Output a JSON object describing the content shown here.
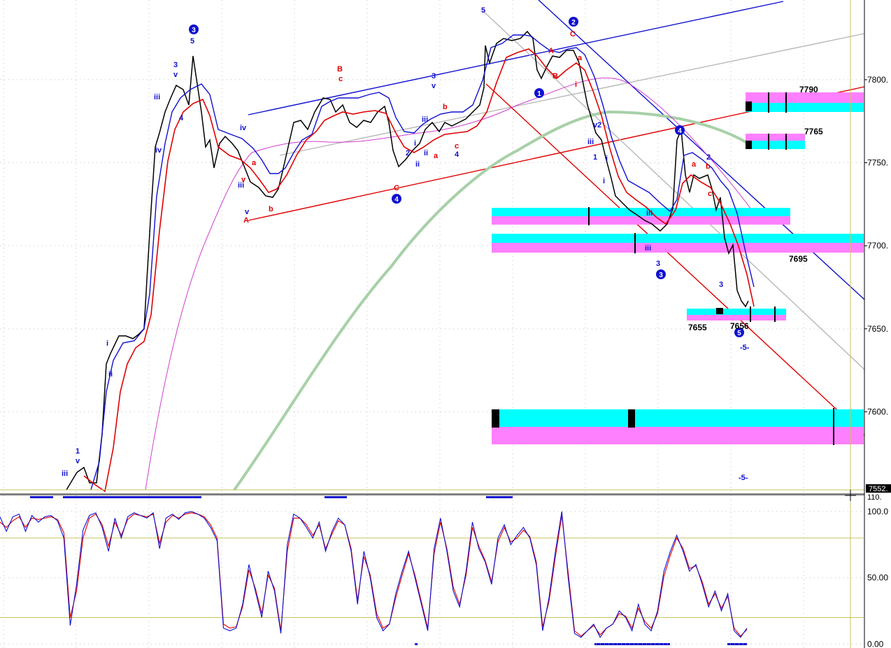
{
  "colors": {
    "blue": "#1010d0",
    "red": "#e00000",
    "magenta": "#d040d0",
    "lightgreen": "#a8d0a8",
    "gray": "#b8b8b8",
    "cyan": "#00ffff",
    "pink": "#ff80ff",
    "olive": "#c8c060",
    "dots": "#c0c0c0"
  },
  "chart_data": [
    {
      "type": "line",
      "panel": "price",
      "y_ticks": [
        {
          "value": 7800,
          "label": "7800."
        },
        {
          "value": 7750,
          "label": "7750."
        },
        {
          "value": 7700,
          "label": "7700."
        },
        {
          "value": 7650,
          "label": "7650."
        },
        {
          "value": 7600,
          "label": "7600."
        }
      ],
      "last_price_label": "7552.",
      "ylim": [
        7553,
        7848
      ],
      "price_levels": [
        {
          "label": "7790",
          "value": 7790
        },
        {
          "label": "7765",
          "value": 7765
        },
        {
          "label": "7695",
          "value": 7695
        },
        {
          "label": "7655",
          "value": 7655
        },
        {
          "label": "7656",
          "value": 7656
        }
      ],
      "wave_labels": {
        "blue": [
          "3",
          "5",
          "3",
          "v",
          "iii",
          "iv",
          "i",
          "ii",
          "1",
          "v",
          "iii",
          "iv",
          "iii",
          "v",
          "4",
          "3",
          "v",
          "iii",
          "i",
          "2",
          "ii",
          "4",
          "5",
          "1",
          "2",
          "v",
          "2",
          "iii",
          "1",
          "i",
          "i",
          "iii",
          "3",
          "4",
          "2",
          "3",
          "5",
          "-5-",
          "-5-",
          "4",
          "ii",
          "iii"
        ],
        "red": [
          "B",
          "c",
          "b",
          "a",
          "a",
          "b",
          "A",
          "v",
          "C",
          "c",
          "a",
          "b",
          "A",
          "B",
          "C",
          "i",
          "a",
          "c",
          "ii",
          "i",
          "4"
        ]
      }
    },
    {
      "type": "line",
      "panel": "stochastic",
      "y_ticks": [
        {
          "value": 100,
          "label": "100.0"
        },
        {
          "value": 50,
          "label": "50.00"
        },
        {
          "value": 0,
          "label": "0.00"
        }
      ],
      "top_label": "110.",
      "ylim": [
        -3,
        110
      ],
      "reference_lines": [
        80,
        20
      ],
      "series": [
        {
          "color": "blue",
          "values": [
            96,
            85,
            96,
            98,
            85,
            97,
            92,
            96,
            97,
            93,
            80,
            14,
            45,
            86,
            97,
            99,
            88,
            70,
            95,
            80,
            96,
            99,
            97,
            95,
            99,
            72,
            95,
            98,
            94,
            99,
            100,
            98,
            95,
            88,
            78,
            12,
            10,
            12,
            30,
            60,
            40,
            20,
            55,
            40,
            8,
            75,
            98,
            95,
            88,
            80,
            92,
            70,
            85,
            95,
            90,
            70,
            30,
            70,
            50,
            20,
            10,
            15,
            38,
            55,
            70,
            50,
            30,
            10,
            72,
            95,
            70,
            40,
            28,
            55,
            92,
            72,
            62,
            45,
            80,
            90,
            75,
            82,
            88,
            80,
            60,
            10,
            35,
            70,
            100,
            50,
            8,
            5,
            10,
            15,
            5,
            12,
            15,
            25,
            20,
            10,
            30,
            15,
            10,
            25,
            55,
            70,
            82,
            70,
            55,
            60,
            45,
            28,
            40,
            25,
            38,
            10,
            5,
            12
          ]
        },
        {
          "color": "red",
          "values": [
            92,
            88,
            93,
            96,
            88,
            95,
            94,
            95,
            96,
            94,
            84,
            20,
            40,
            80,
            95,
            98,
            90,
            74,
            92,
            82,
            94,
            98,
            97,
            96,
            98,
            76,
            92,
            97,
            95,
            98,
            99,
            98,
            96,
            90,
            80,
            15,
            12,
            13,
            28,
            56,
            42,
            23,
            52,
            42,
            10,
            70,
            95,
            95,
            90,
            82,
            90,
            72,
            83,
            93,
            90,
            72,
            33,
            66,
            52,
            23,
            12,
            15,
            35,
            52,
            68,
            52,
            32,
            12,
            68,
            92,
            72,
            43,
            30,
            52,
            88,
            74,
            63,
            47,
            77,
            88,
            77,
            80,
            86,
            81,
            62,
            13,
            32,
            66,
            97,
            54,
            10,
            6,
            10,
            14,
            7,
            12,
            15,
            23,
            21,
            12,
            27,
            17,
            12,
            23,
            51,
            67,
            80,
            72,
            57,
            59,
            47,
            30,
            38,
            27,
            36,
            12,
            6,
            11
          ]
        }
      ]
    }
  ]
}
